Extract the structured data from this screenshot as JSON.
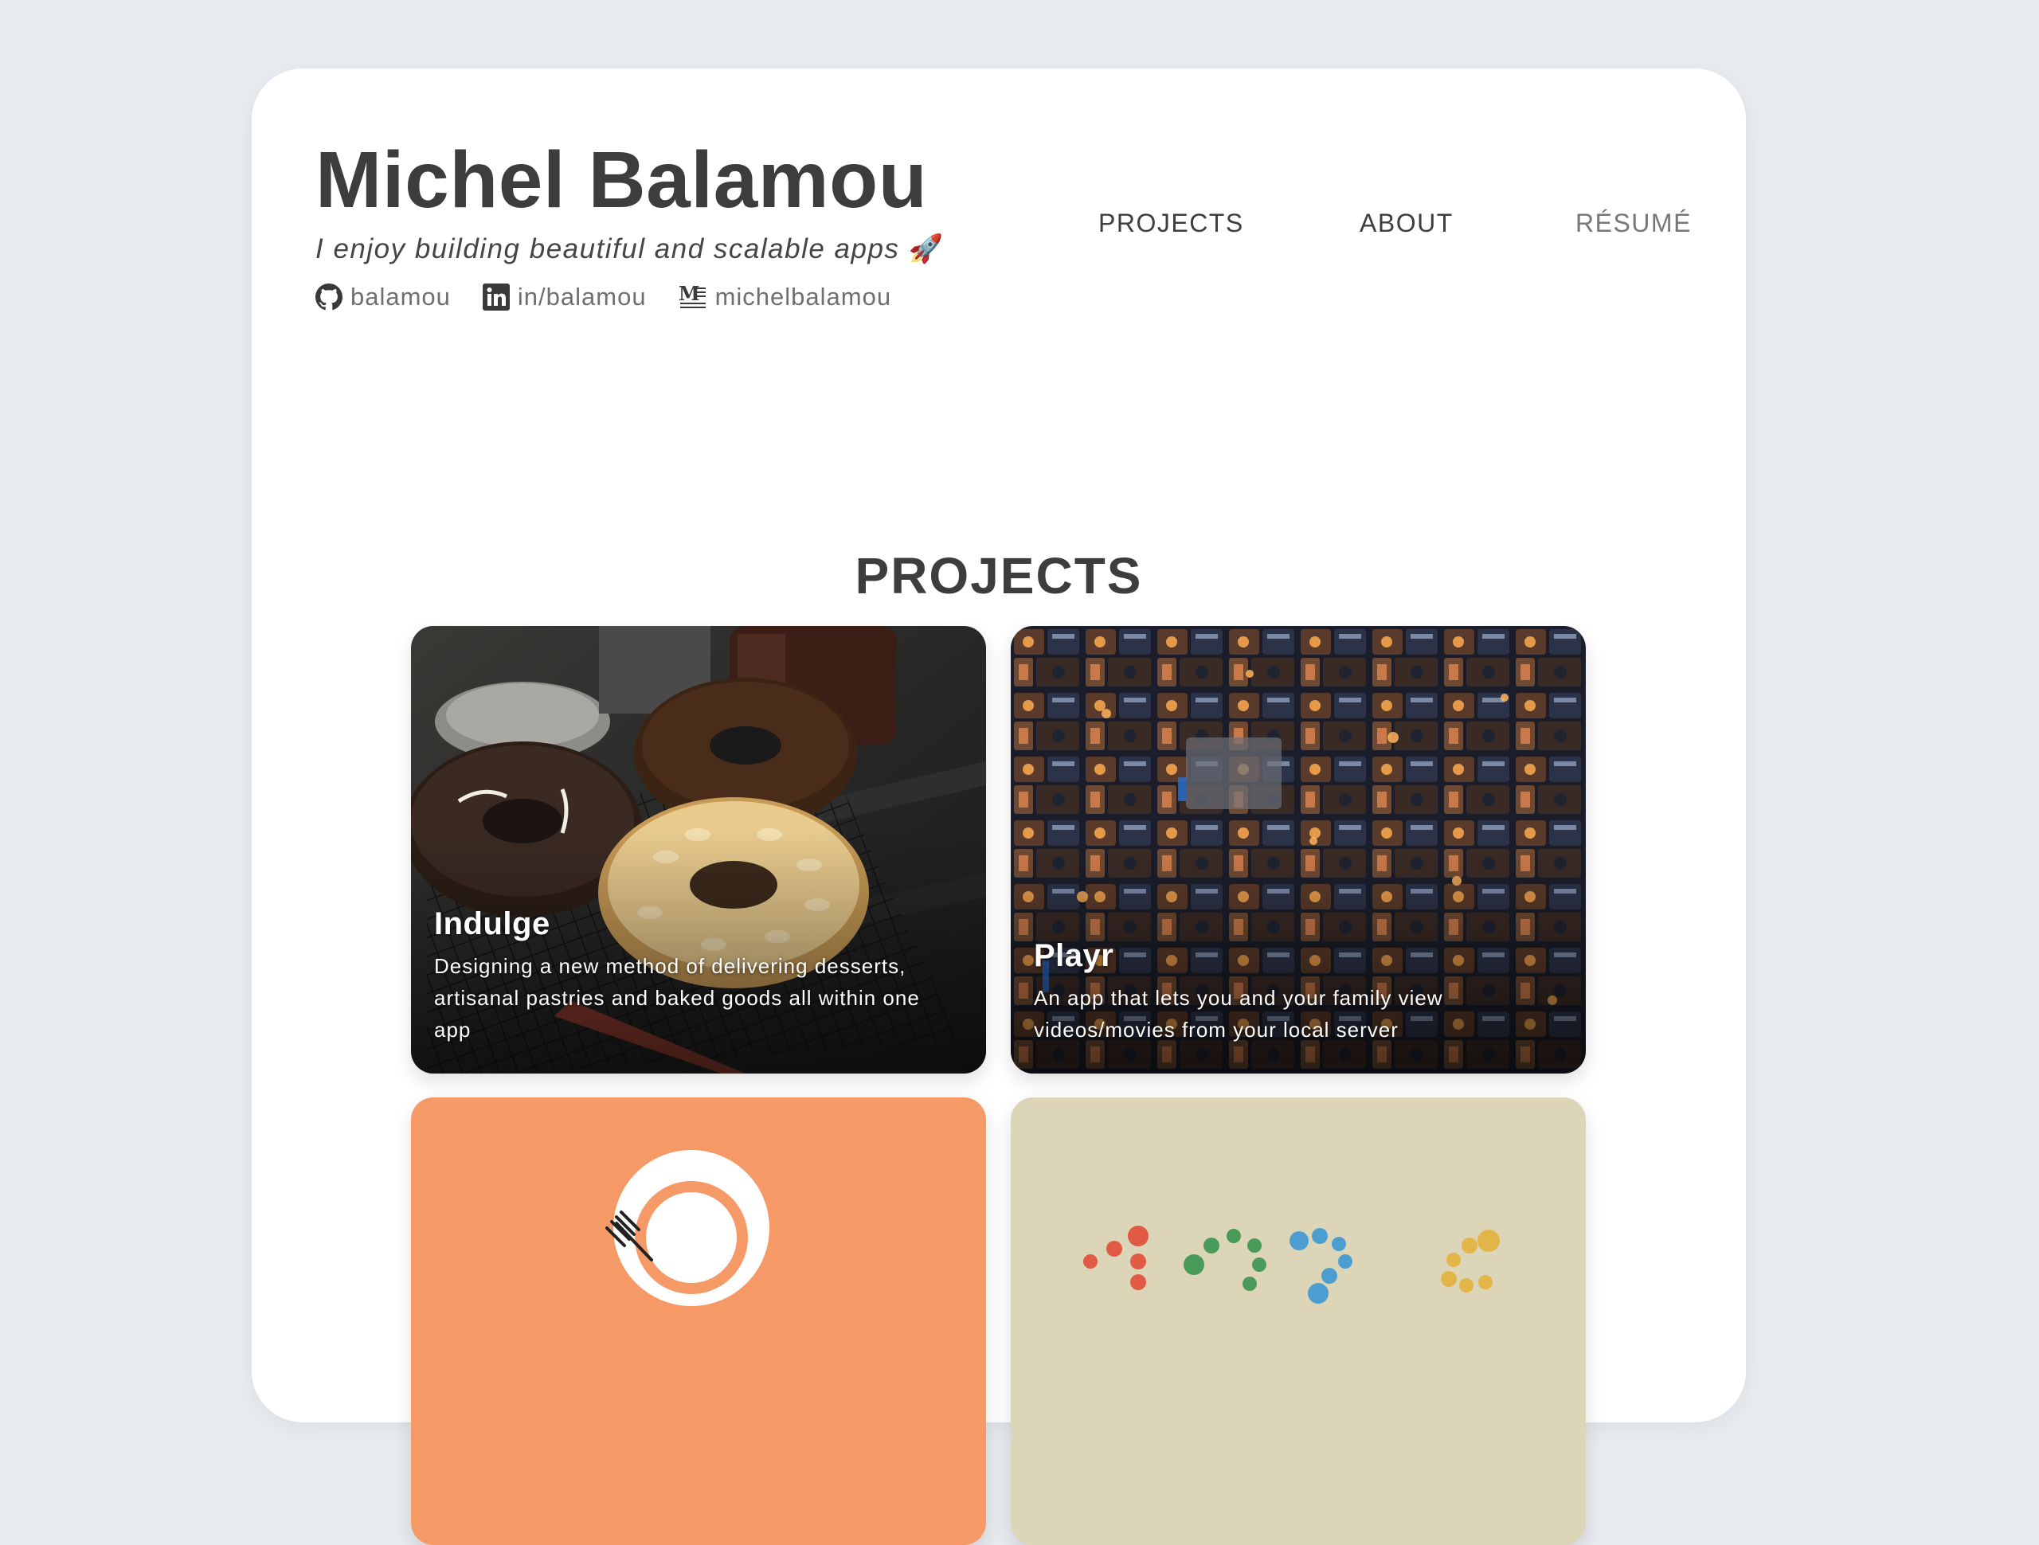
{
  "header": {
    "name": "Michel Balamou",
    "tagline": "I enjoy building beautiful and scalable apps",
    "tagline_emoji": "🚀",
    "socials": [
      {
        "icon": "github-icon",
        "label": "balamou"
      },
      {
        "icon": "linkedin-icon",
        "label": "in/balamou"
      },
      {
        "icon": "medium-icon",
        "label": "michelbalamou"
      }
    ]
  },
  "nav": {
    "projects": "PROJECTS",
    "about": "ABOUT",
    "resume": "RÉSUMÉ"
  },
  "projects_section": {
    "title": "PROJECTS",
    "cards": [
      {
        "title": "Indulge",
        "description": "Designing a new method of delivering desserts, artisanal pastries and baked goods all within one app"
      },
      {
        "title": "Playr",
        "description": "An app that lets you and your family view videos/movies from your local server"
      },
      {
        "title": "",
        "description": ""
      },
      {
        "title": "",
        "description": ""
      }
    ]
  },
  "colors": {
    "background": "#e8ebef",
    "card": "#ffffff",
    "heading": "#3d3d3d",
    "muted_link": "#6f6f6f",
    "orange_card": "#f59a67",
    "beige_card": "#dcd5b8"
  }
}
